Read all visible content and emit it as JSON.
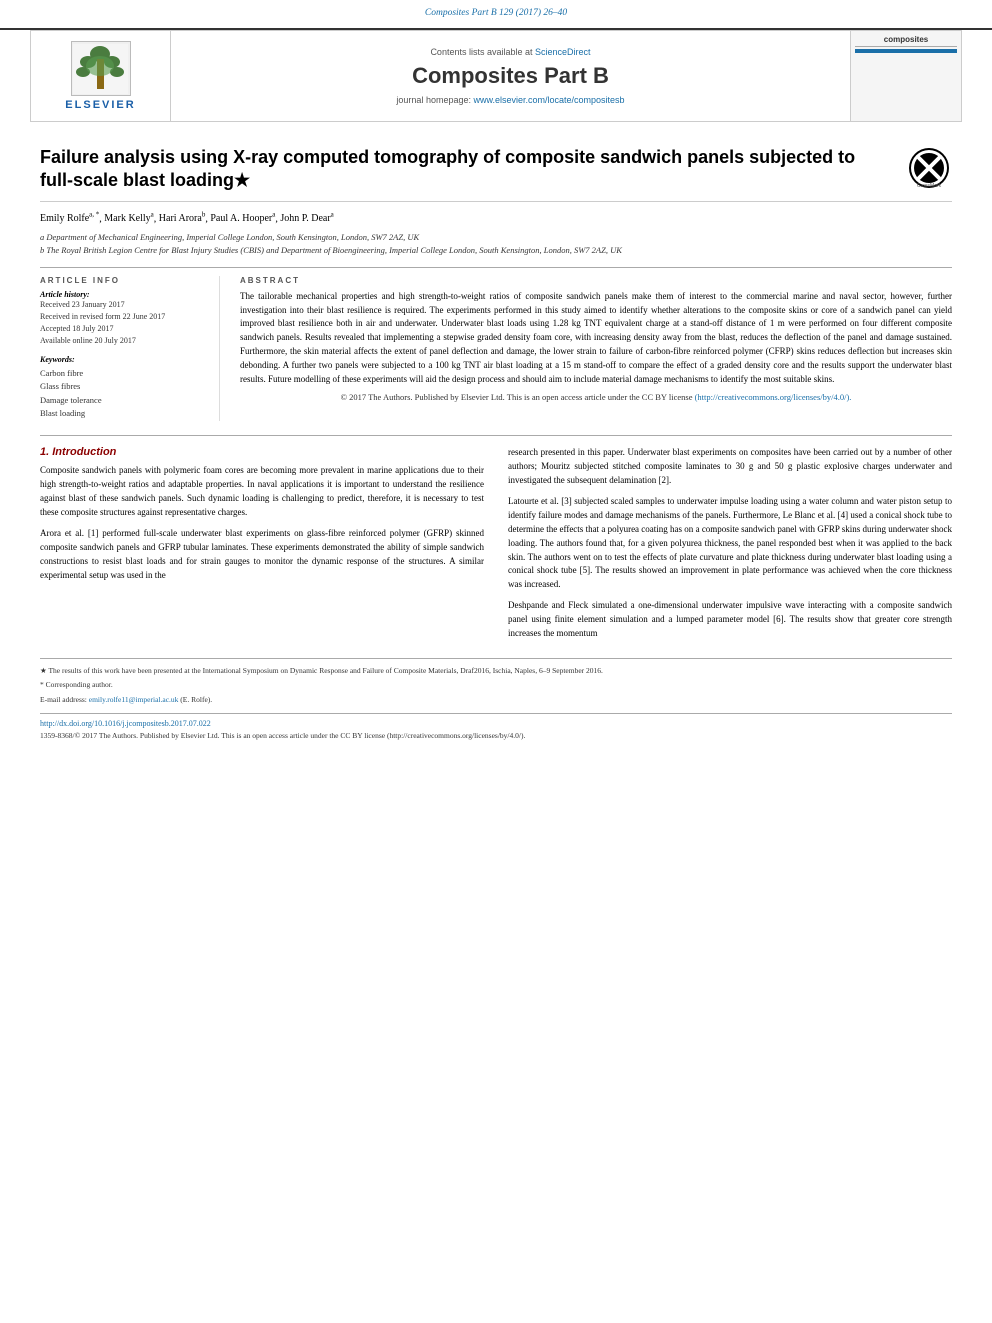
{
  "journal_ref": "Composites Part B 129 (2017) 26–40",
  "contents_text": "Contents lists available at",
  "sciencedirect_link": "ScienceDirect",
  "journal_name": "Composites Part B",
  "homepage_text": "journal homepage:",
  "homepage_url": "www.elsevier.com/locate/compositesb",
  "article": {
    "title": "Failure analysis using X-ray computed tomography of composite sandwich panels subjected to full-scale blast loading★",
    "authors": "Emily Rolfe a, *, Mark Kelly a, Hari Arora b, Paul A. Hooper a, John P. Dear a",
    "affiliation_a": "a Department of Mechanical Engineering, Imperial College London, South Kensington, London, SW7 2AZ, UK",
    "affiliation_b": "b The Royal British Legion Centre for Blast Injury Studies (CBIS) and Department of Bioengineering, Imperial College London, South Kensington, London, SW7 2AZ, UK"
  },
  "article_info": {
    "header": "ARTICLE INFO",
    "history_label": "Article history:",
    "received": "Received 23 January 2017",
    "revised": "Received in revised form 22 June 2017",
    "accepted": "Accepted 18 July 2017",
    "available": "Available online 20 July 2017",
    "keywords_label": "Keywords:",
    "keywords": [
      "Carbon fibre",
      "Glass fibres",
      "Damage tolerance",
      "Blast loading"
    ]
  },
  "abstract": {
    "header": "ABSTRACT",
    "text": "The tailorable mechanical properties and high strength-to-weight ratios of composite sandwich panels make them of interest to the commercial marine and naval sector, however, further investigation into their blast resilience is required. The experiments performed in this study aimed to identify whether alterations to the composite skins or core of a sandwich panel can yield improved blast resilience both in air and underwater. Underwater blast loads using 1.28 kg TNT equivalent charge at a stand-off distance of 1 m were performed on four different composite sandwich panels. Results revealed that implementing a stepwise graded density foam core, with increasing density away from the blast, reduces the deflection of the panel and damage sustained. Furthermore, the skin material affects the extent of panel deflection and damage, the lower strain to failure of carbon-fibre reinforced polymer (CFRP) skins reduces deflection but increases skin debonding. A further two panels were subjected to a 100 kg TNT air blast loading at a 15 m stand-off to compare the effect of a graded density core and the results support the underwater blast results. Future modelling of these experiments will aid the design process and should aim to include material damage mechanisms to identify the most suitable skins.",
    "cc_text": "© 2017 The Authors. Published by Elsevier Ltd. This is an open access article under the CC BY license",
    "cc_url": "(http://creativecommons.org/licenses/by/4.0/)."
  },
  "introduction": {
    "section_num": "1.",
    "section_title": "Introduction",
    "para1": "Composite sandwich panels with polymeric foam cores are becoming more prevalent in marine applications due to their high strength-to-weight ratios and adaptable properties. In naval applications it is important to understand the resilience against blast of these sandwich panels. Such dynamic loading is challenging to predict, therefore, it is necessary to test these composite structures against representative charges.",
    "para2": "Arora et al. [1] performed full-scale underwater blast experiments on glass-fibre reinforced polymer (GFRP) skinned composite sandwich panels and GFRP tubular laminates. These experiments demonstrated the ability of simple sandwich constructions to resist blast loads and for strain gauges to monitor the dynamic response of the structures. A similar experimental setup was used in the"
  },
  "intro_right": {
    "para1": "research presented in this paper. Underwater blast experiments on composites have been carried out by a number of other authors; Mouritz subjected stitched composite laminates to 30 g and 50 g plastic explosive charges underwater and investigated the subsequent delamination [2].",
    "para2": "Latourte et al. [3] subjected scaled samples to underwater impulse loading using a water column and water piston setup to identify failure modes and damage mechanisms of the panels. Furthermore, Le Blanc et al. [4] used a conical shock tube to determine the effects that a polyurea coating has on a composite sandwich panel with GFRP skins during underwater shock loading. The authors found that, for a given polyurea thickness, the panel responded best when it was applied to the back skin. The authors went on to test the effects of plate curvature and plate thickness during underwater blast loading using a conical shock tube [5]. The results showed an improvement in plate performance was achieved when the core thickness was increased.",
    "para3": "Deshpande and Fleck simulated a one-dimensional underwater impulsive wave interacting with a composite sandwich panel using finite element simulation and a lumped parameter model [6]. The results show that greater core strength increases the momentum"
  },
  "footnotes": {
    "star": "★ The results of this work have been presented at the International Symposium on Dynamic Response and Failure of Composite Materials, Draf2016, Ischia, Naples, 6–9 September 2016.",
    "corresponding": "* Corresponding author.",
    "email_label": "E-mail address:",
    "email": "emily.rolfe11@imperial.ac.uk",
    "email_suffix": "(E. Rolfe)."
  },
  "bottom": {
    "doi": "http://dx.doi.org/10.1016/j.jcompositesb.2017.07.022",
    "copyright": "1359-8368/© 2017 The Authors. Published by Elsevier Ltd. This is an open access article under the CC BY license (http://creativecommons.org/licenses/by/4.0/)."
  }
}
